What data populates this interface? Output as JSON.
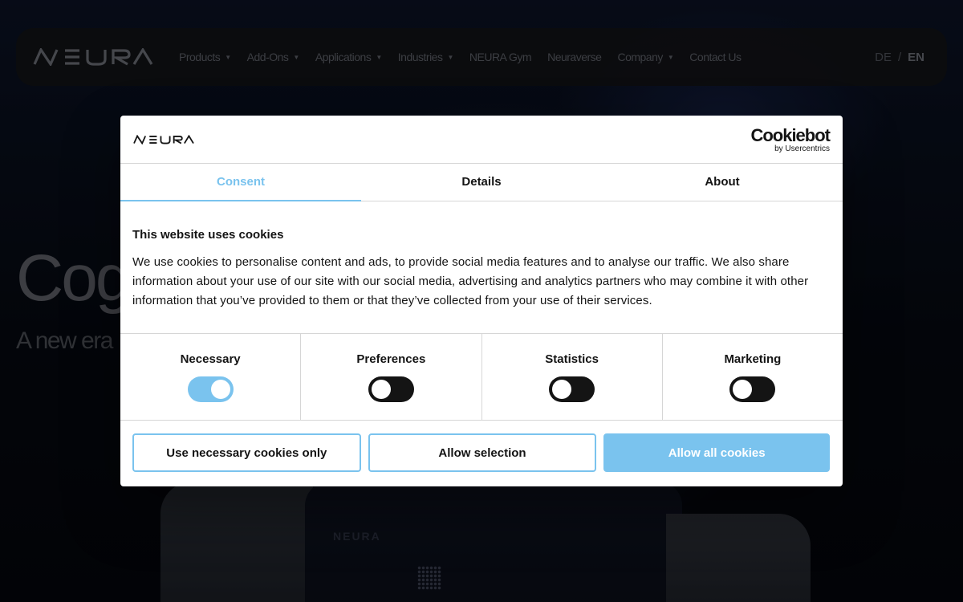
{
  "brand": {
    "logo_text": "NEURA",
    "accent_color": "#7ac3ee"
  },
  "nav": {
    "items": [
      {
        "label": "Products",
        "has_dropdown": true
      },
      {
        "label": "Add-Ons",
        "has_dropdown": true
      },
      {
        "label": "Applications",
        "has_dropdown": true
      },
      {
        "label": "Industries",
        "has_dropdown": true
      },
      {
        "label": "NEURA Gym",
        "has_dropdown": false
      },
      {
        "label": "Neuraverse",
        "has_dropdown": false
      },
      {
        "label": "Company",
        "has_dropdown": true
      },
      {
        "label": "Contact Us",
        "has_dropdown": false
      }
    ],
    "lang": {
      "de": "DE",
      "separator": "/",
      "en": "EN",
      "active": "EN"
    }
  },
  "hero": {
    "title": "Cog",
    "subtitle": "A new era"
  },
  "robot": {
    "label": "NEURA"
  },
  "cookie_dialog": {
    "provider_name": "Cookiebot",
    "provider_by": "by Usercentrics",
    "tabs": [
      {
        "label": "Consent",
        "active": true
      },
      {
        "label": "Details",
        "active": false
      },
      {
        "label": "About",
        "active": false
      }
    ],
    "title": "This website uses cookies",
    "text": "We use cookies to personalise content and ads, to provide social media features and to analyse our traffic. We also share information about your use of our site with our social media, advertising and analytics partners who may combine it with other information that you’ve provided to them or that they’ve collected from your use of their services.",
    "categories": [
      {
        "label": "Necessary",
        "enabled": true
      },
      {
        "label": "Preferences",
        "enabled": false
      },
      {
        "label": "Statistics",
        "enabled": false
      },
      {
        "label": "Marketing",
        "enabled": false
      }
    ],
    "buttons": {
      "necessary_only": "Use necessary cookies only",
      "allow_selection": "Allow selection",
      "allow_all": "Allow all cookies"
    }
  }
}
